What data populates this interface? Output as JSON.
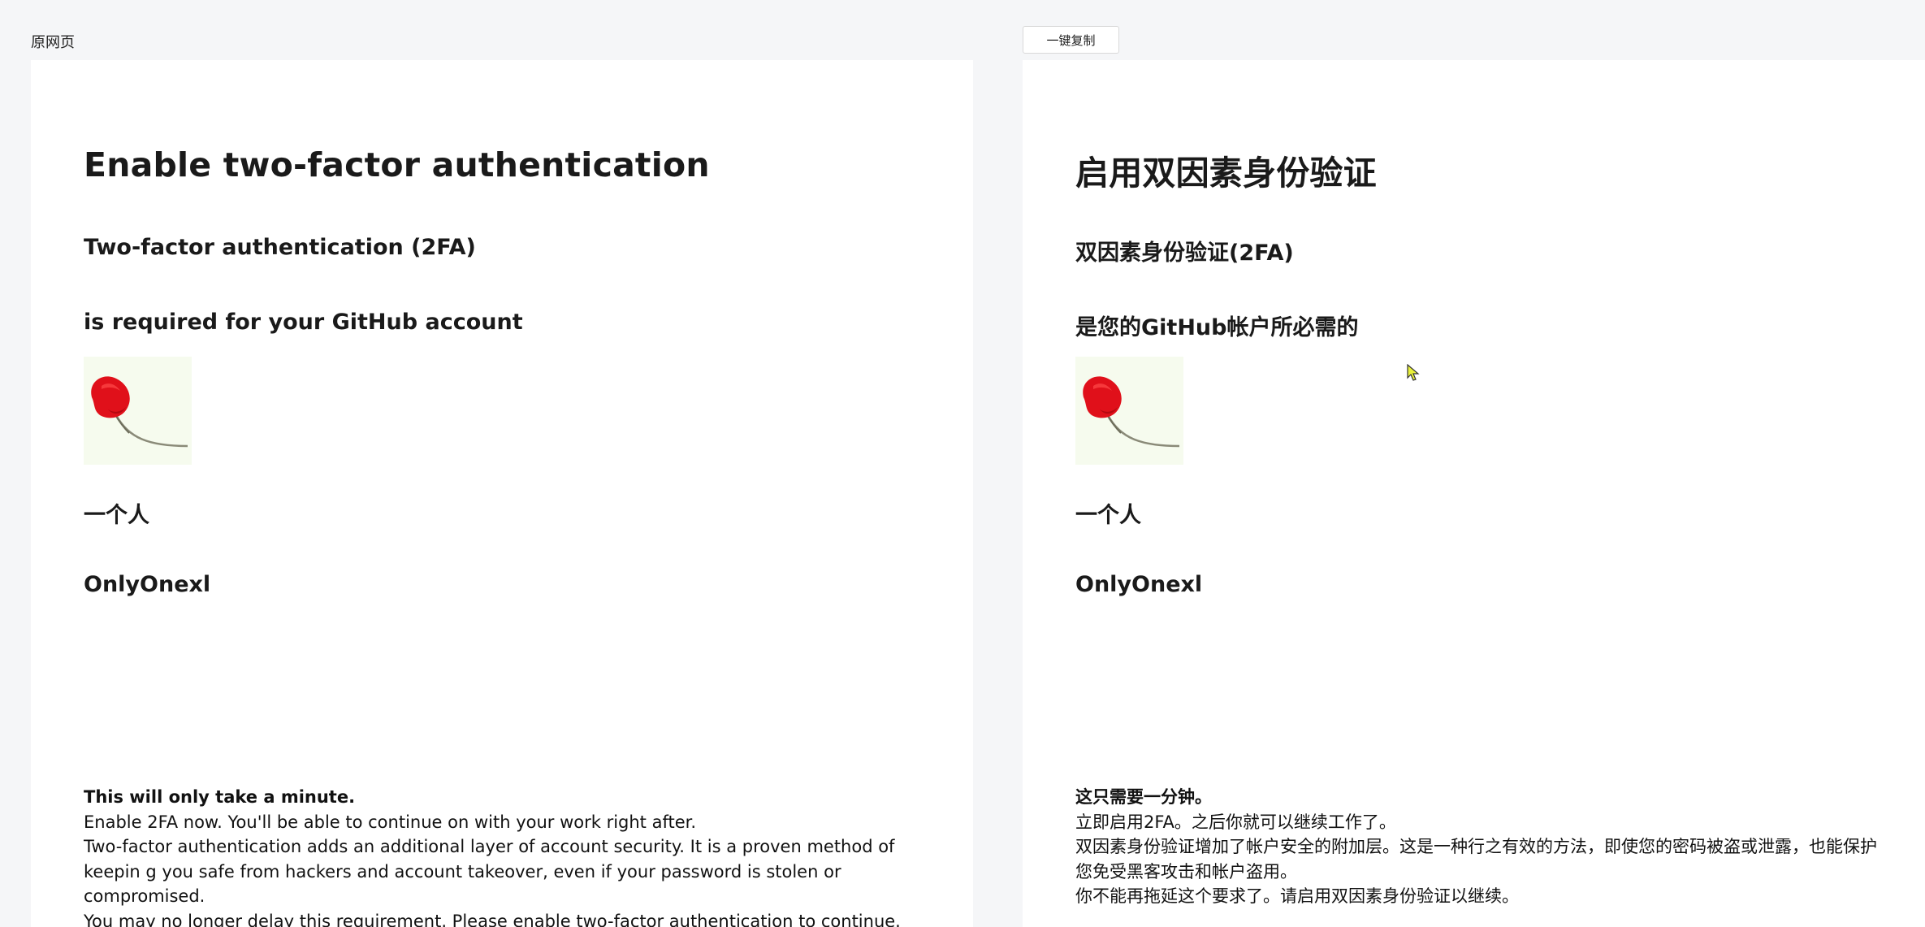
{
  "header": {
    "original_label": "原网页",
    "copy_button": "一键复制"
  },
  "left": {
    "title": "Enable two-factor authentication",
    "subtitle1": "Two-factor authentication (2FA)",
    "subtitle2": "is required for your GitHub account",
    "user_label": "一个人",
    "username": "OnlyOnexl",
    "para_strong": "This will only take a minute.",
    "para1": "Enable 2FA now. You'll be able to continue on with your work right after.",
    "para2": "Two-factor authentication adds an additional layer of account security. It is a proven method of keepin g you safe from hackers and account takeover, even if your password is stolen or compromised.",
    "para3": "You may no longer delay this requirement. Please enable two-factor authentication to continue."
  },
  "right": {
    "title": "启用双因素身份验证",
    "subtitle1": "双因素身份验证(2FA)",
    "subtitle2": "是您的GitHub帐户所必需的",
    "user_label": "一个人",
    "username": "OnlyOnexl",
    "para_strong": "这只需要一分钟。",
    "para1": "立即启用2FA。之后你就可以继续工作了。",
    "para2": "双因素身份验证增加了帐户安全的附加层。这是一种行之有效的方法，即使您的密码被盗或泄露，也能保护您免受黑客攻击和帐户盗用。",
    "para3": "你不能再拖延这个要求了。请启用双因素身份验证以继续。"
  },
  "colors": {
    "page_bg": "#f5f6f8",
    "panel_bg": "#ffffff",
    "avatar_bg": "#f6fbee",
    "flower_red": "#e0101a",
    "cursor": "#e8f03a"
  },
  "icons": {
    "avatar": "red-flower-icon",
    "cursor": "mouse-pointer-icon"
  }
}
